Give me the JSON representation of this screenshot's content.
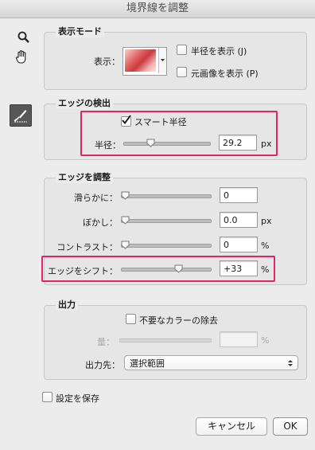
{
  "window": {
    "title": "境界線を調整"
  },
  "tools": [
    "zoom-icon",
    "hand-icon",
    "refine-radius-brush-icon"
  ],
  "view_mode": {
    "legend": "表示モード",
    "view_label": "表示：",
    "show_radius": "半径を表示 (J)",
    "show_original": "元画像を表示 (P)"
  },
  "edge_detection": {
    "legend": "エッジの検出",
    "smart_radius": "スマート半径",
    "smart_radius_checked": true,
    "radius_label": "半径：",
    "radius_value": "29.2",
    "radius_unit": "px",
    "radius_level": 0.3
  },
  "adjust_edge": {
    "legend": "エッジを調整",
    "rows": [
      {
        "label": "滑らかに：",
        "value": "0",
        "unit": "",
        "level": 0.0
      },
      {
        "label": "ぼかし：",
        "value": "0.0",
        "unit": "px",
        "level": 0.0
      },
      {
        "label": "コントラスト：",
        "value": "0",
        "unit": "%",
        "level": 0.0
      },
      {
        "label": "エッジをシフト：",
        "value": "+33",
        "unit": "%",
        "level": 0.66
      }
    ]
  },
  "output": {
    "legend": "出力",
    "decontaminate": "不要なカラーの除去",
    "amount_label": "量：",
    "amount_unit": "%",
    "output_to_label": "出力先：",
    "output_to_value": "選択範囲"
  },
  "remember": "設定を保存",
  "buttons": {
    "cancel": "キャンセル",
    "ok": "OK"
  },
  "highlight_color": "#e3236a"
}
